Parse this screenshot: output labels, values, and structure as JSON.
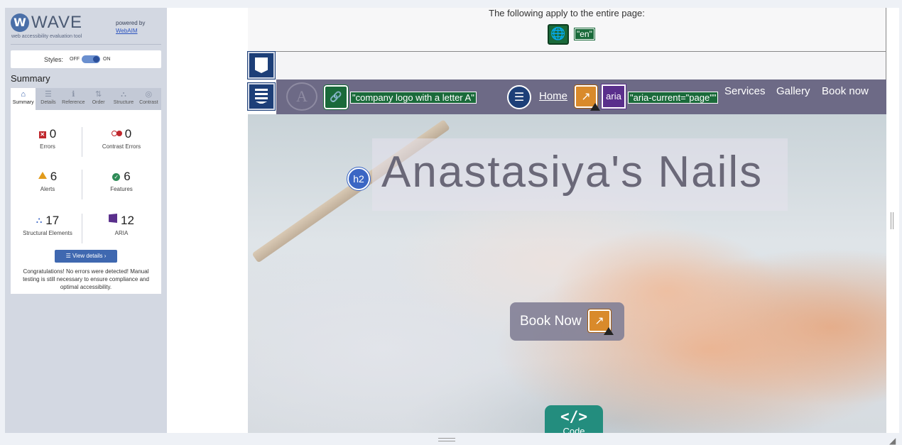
{
  "wave": {
    "brand_name": "WAVE",
    "brand_tagline": "web accessibility evaluation tool",
    "logo_letter": "W",
    "powered_by": "powered by",
    "webaim_link": "WebAIM",
    "styles_label": "Styles:",
    "styles_off": "OFF",
    "styles_on": "ON",
    "summary_heading": "Summary",
    "tabs": [
      {
        "label": "Summary",
        "icon": "home-icon",
        "glyph": "⌂"
      },
      {
        "label": "Details",
        "icon": "list-icon",
        "glyph": "☰"
      },
      {
        "label": "Reference",
        "icon": "info-icon",
        "glyph": "ℹ"
      },
      {
        "label": "Order",
        "icon": "order-icon",
        "glyph": "⇅"
      },
      {
        "label": "Structure",
        "icon": "structure-icon",
        "glyph": "⛬"
      },
      {
        "label": "Contrast",
        "icon": "contrast-icon",
        "glyph": "◎"
      }
    ],
    "stats": {
      "errors": {
        "value": "0",
        "label": "Errors"
      },
      "contrast_errors": {
        "value": "0",
        "label": "Contrast Errors"
      },
      "alerts": {
        "value": "6",
        "label": "Alerts"
      },
      "features": {
        "value": "6",
        "label": "Features"
      },
      "structural": {
        "value": "17",
        "label": "Structural Elements"
      },
      "aria": {
        "value": "12",
        "label": "ARIA"
      }
    },
    "view_details": "View details ›",
    "congrats": "Congratulations! No errors were detected! Manual testing is still necessary to ensure compliance and optimal accessibility."
  },
  "page": {
    "applies_text": "The following apply to the entire page:",
    "lang_tag": "\"en\"",
    "nav": {
      "logo_letter": "A",
      "logo_alt": "\"company logo with a letter A\"",
      "home": "Home",
      "aria_label": "aria",
      "aria_current": "\"aria-current=\"page\"\"",
      "services": "Services",
      "gallery": "Gallery",
      "book_now": "Book now"
    },
    "hero_title": "Anastasiya's Nails",
    "h2_badge": "h2",
    "book_button": "Book Now",
    "code_label": "Code",
    "code_symbol": "</>"
  },
  "colors": {
    "feature_green": "#1a6a3a",
    "structure_blue": "#1d3f78",
    "aria_purple": "#5a2f8c",
    "alert_orange": "#d98a2b",
    "navbar": "#6d6a86"
  }
}
